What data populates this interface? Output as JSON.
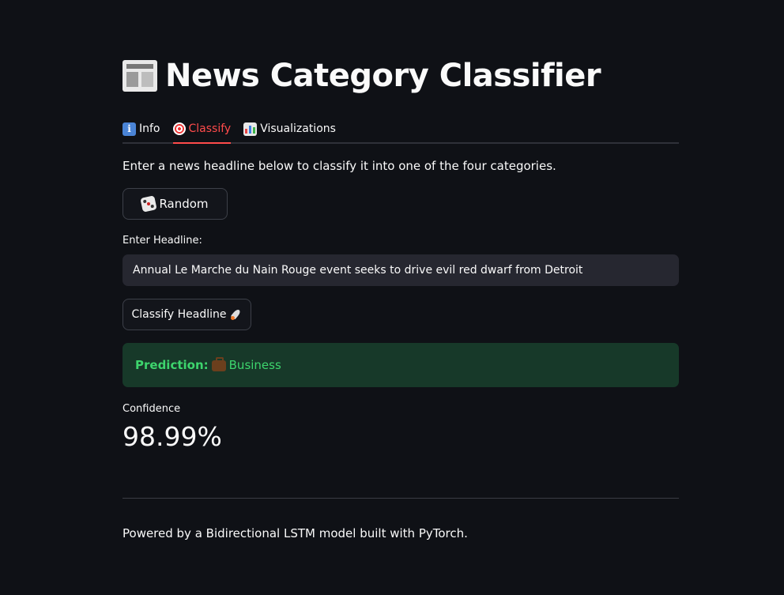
{
  "app": {
    "title": "News Category Classifier",
    "title_icon": "newspaper-icon"
  },
  "tabs": [
    {
      "label": "Info",
      "icon": "info-icon",
      "active": false
    },
    {
      "label": "Classify",
      "icon": "target-icon",
      "active": true
    },
    {
      "label": "Visualizations",
      "icon": "bar-chart-icon",
      "active": false
    }
  ],
  "classify": {
    "description": "Enter a news headline below to classify it into one of the four categories.",
    "random_button": {
      "label": "Random",
      "icon": "dice-icon"
    },
    "headline_label": "Enter Headline:",
    "headline_value": "Annual Le Marche du Nain Rouge event seeks to drive evil red dwarf from Detroit",
    "classify_button": {
      "label": "Classify Headline",
      "icon": "rocket-icon"
    },
    "prediction": {
      "prefix": "Prediction:",
      "category": "Business",
      "icon": "briefcase-icon"
    },
    "confidence": {
      "label": "Confidence",
      "value": "98.99%"
    }
  },
  "footer": {
    "text": "Powered by a Bidirectional LSTM model built with PyTorch."
  },
  "colors": {
    "background": "#0f1116",
    "accent": "#ff4b4b",
    "success_bg": "#173929",
    "success_text": "#3dd56d",
    "input_bg": "#262730"
  }
}
